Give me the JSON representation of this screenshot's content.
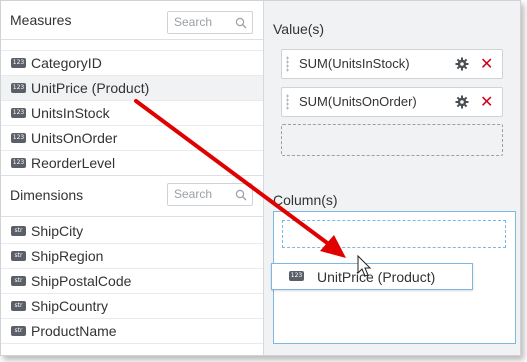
{
  "measures": {
    "title": "Measures",
    "search_placeholder": "Search",
    "items": [
      {
        "badge": "123",
        "label": "CategoryID"
      },
      {
        "badge": "123",
        "label": "UnitPrice (Product)"
      },
      {
        "badge": "123",
        "label": "UnitsInStock"
      },
      {
        "badge": "123",
        "label": "UnitsOnOrder"
      },
      {
        "badge": "123",
        "label": "ReorderLevel"
      }
    ]
  },
  "dimensions": {
    "title": "Dimensions",
    "search_placeholder": "Search",
    "items": [
      {
        "badge": "str",
        "label": "ShipCity"
      },
      {
        "badge": "str",
        "label": "ShipRegion"
      },
      {
        "badge": "str",
        "label": "ShipPostalCode"
      },
      {
        "badge": "str",
        "label": "ShipCountry"
      },
      {
        "badge": "str",
        "label": "ProductName"
      }
    ]
  },
  "values": {
    "title": "Value(s)",
    "items": [
      {
        "label": "SUM(UnitsInStock)"
      },
      {
        "label": "SUM(UnitsOnOrder)"
      }
    ]
  },
  "columns": {
    "title": "Column(s)"
  },
  "drag": {
    "badge": "123",
    "label": "UnitPrice (Product)"
  },
  "colors": {
    "arrow": "#e00000",
    "close": "#d0021b",
    "accent": "#7fb7e3"
  }
}
